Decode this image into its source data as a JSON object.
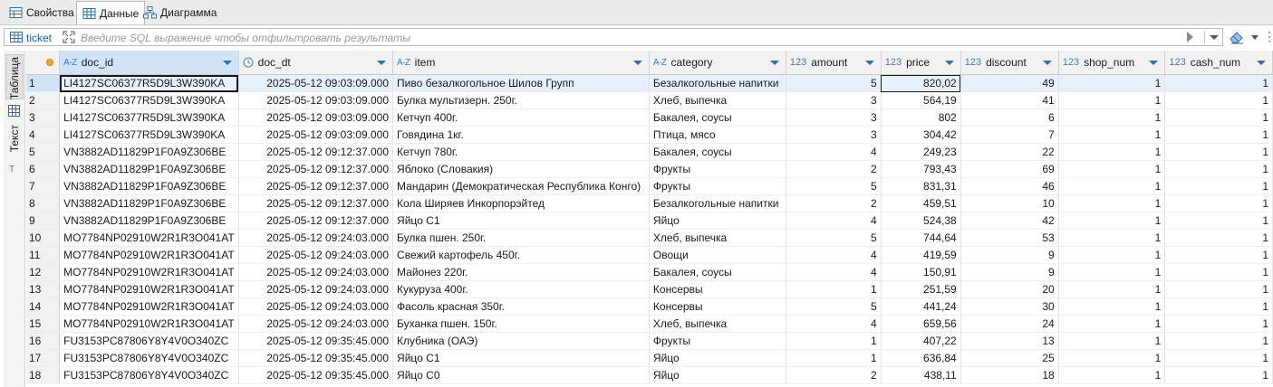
{
  "tabs": [
    {
      "label": "Свойства",
      "icon": "properties-icon"
    },
    {
      "label": "Данные",
      "icon": "grid-icon"
    },
    {
      "label": "Диаграмма",
      "icon": "diagram-icon"
    }
  ],
  "filter": {
    "table_name": "ticket",
    "placeholder": "Введите SQL выражение чтобы отфильтровать результаты"
  },
  "side_tabs": {
    "table": "Таблица",
    "text": "Текст"
  },
  "columns": [
    {
      "name": "doc_id",
      "type": "A-Z"
    },
    {
      "name": "doc_dt",
      "type": "clock"
    },
    {
      "name": "item",
      "type": "A-Z"
    },
    {
      "name": "category",
      "type": "A-Z"
    },
    {
      "name": "amount",
      "type": "123"
    },
    {
      "name": "price",
      "type": "123"
    },
    {
      "name": "discount",
      "type": "123"
    },
    {
      "name": "shop_num",
      "type": "123"
    },
    {
      "name": "cash_num",
      "type": "123"
    }
  ],
  "rows": [
    {
      "n": "1",
      "doc_id": "LI4127SC06377R5D9L3W390KA",
      "doc_dt": "2025-05-12 09:03:09.000",
      "item": "Пиво безалкогольное Шилов Групп",
      "category": "Безалкогольные напитки",
      "amount": "5",
      "price": "820,02",
      "discount": "49",
      "shop_num": "1",
      "cash_num": "1"
    },
    {
      "n": "2",
      "doc_id": "LI4127SC06377R5D9L3W390KA",
      "doc_dt": "2025-05-12 09:03:09.000",
      "item": "Булка мультизерн. 250г.",
      "category": "Хлеб, выпечка",
      "amount": "3",
      "price": "564,19",
      "discount": "41",
      "shop_num": "1",
      "cash_num": "1"
    },
    {
      "n": "3",
      "doc_id": "LI4127SC06377R5D9L3W390KA",
      "doc_dt": "2025-05-12 09:03:09.000",
      "item": "Кетчуп 400г.",
      "category": "Бакалея, соусы",
      "amount": "3",
      "price": "802",
      "discount": "6",
      "shop_num": "1",
      "cash_num": "1"
    },
    {
      "n": "4",
      "doc_id": "LI4127SC06377R5D9L3W390KA",
      "doc_dt": "2025-05-12 09:03:09.000",
      "item": "Говядина 1кг.",
      "category": "Птица, мясо",
      "amount": "3",
      "price": "304,42",
      "discount": "7",
      "shop_num": "1",
      "cash_num": "1"
    },
    {
      "n": "5",
      "doc_id": "VN3882AD11829P1F0A9Z306BE",
      "doc_dt": "2025-05-12 09:12:37.000",
      "item": "Кетчуп 780г.",
      "category": "Бакалея, соусы",
      "amount": "4",
      "price": "249,23",
      "discount": "22",
      "shop_num": "1",
      "cash_num": "1"
    },
    {
      "n": "6",
      "doc_id": "VN3882AD11829P1F0A9Z306BE",
      "doc_dt": "2025-05-12 09:12:37.000",
      "item": "Яблоко (Словакия)",
      "category": "Фрукты",
      "amount": "2",
      "price": "793,43",
      "discount": "69",
      "shop_num": "1",
      "cash_num": "1"
    },
    {
      "n": "7",
      "doc_id": "VN3882AD11829P1F0A9Z306BE",
      "doc_dt": "2025-05-12 09:12:37.000",
      "item": "Мандарин (Демократическая Республика Конго)",
      "category": "Фрукты",
      "amount": "5",
      "price": "831,31",
      "discount": "46",
      "shop_num": "1",
      "cash_num": "1"
    },
    {
      "n": "8",
      "doc_id": "VN3882AD11829P1F0A9Z306BE",
      "doc_dt": "2025-05-12 09:12:37.000",
      "item": "Кола Ширяев Инкорпорэйтед",
      "category": "Безалкогольные напитки",
      "amount": "2",
      "price": "459,51",
      "discount": "10",
      "shop_num": "1",
      "cash_num": "1"
    },
    {
      "n": "9",
      "doc_id": "VN3882AD11829P1F0A9Z306BE",
      "doc_dt": "2025-05-12 09:12:37.000",
      "item": "Яйцо С1",
      "category": "Яйцо",
      "amount": "4",
      "price": "524,38",
      "discount": "42",
      "shop_num": "1",
      "cash_num": "1"
    },
    {
      "n": "10",
      "doc_id": "MO7784NP02910W2R1R3O041AT",
      "doc_dt": "2025-05-12 09:24:03.000",
      "item": "Булка пшен. 250г.",
      "category": "Хлеб, выпечка",
      "amount": "5",
      "price": "744,64",
      "discount": "53",
      "shop_num": "1",
      "cash_num": "1"
    },
    {
      "n": "11",
      "doc_id": "MO7784NP02910W2R1R3O041AT",
      "doc_dt": "2025-05-12 09:24:03.000",
      "item": "Свежий картофель 450г.",
      "category": "Овощи",
      "amount": "4",
      "price": "419,59",
      "discount": "9",
      "shop_num": "1",
      "cash_num": "1"
    },
    {
      "n": "12",
      "doc_id": "MO7784NP02910W2R1R3O041AT",
      "doc_dt": "2025-05-12 09:24:03.000",
      "item": "Майонез 220г.",
      "category": "Бакалея, соусы",
      "amount": "4",
      "price": "150,91",
      "discount": "9",
      "shop_num": "1",
      "cash_num": "1"
    },
    {
      "n": "13",
      "doc_id": "MO7784NP02910W2R1R3O041AT",
      "doc_dt": "2025-05-12 09:24:03.000",
      "item": "Кукуруза 400г.",
      "category": "Консервы",
      "amount": "1",
      "price": "251,59",
      "discount": "20",
      "shop_num": "1",
      "cash_num": "1"
    },
    {
      "n": "14",
      "doc_id": "MO7784NP02910W2R1R3O041AT",
      "doc_dt": "2025-05-12 09:24:03.000",
      "item": "Фасоль красная 350г.",
      "category": "Консервы",
      "amount": "5",
      "price": "441,24",
      "discount": "30",
      "shop_num": "1",
      "cash_num": "1"
    },
    {
      "n": "15",
      "doc_id": "MO7784NP02910W2R1R3O041AT",
      "doc_dt": "2025-05-12 09:24:03.000",
      "item": "Буханка пшен. 150г.",
      "category": "Хлеб, выпечка",
      "amount": "4",
      "price": "659,56",
      "discount": "24",
      "shop_num": "1",
      "cash_num": "1"
    },
    {
      "n": "16",
      "doc_id": "FU3153PC87806Y8Y4V0O340ZC",
      "doc_dt": "2025-05-12 09:35:45.000",
      "item": "Клубника (ОАЭ)",
      "category": "Фрукты",
      "amount": "1",
      "price": "407,22",
      "discount": "13",
      "shop_num": "1",
      "cash_num": "1"
    },
    {
      "n": "17",
      "doc_id": "FU3153PC87806Y8Y4V0O340ZC",
      "doc_dt": "2025-05-12 09:35:45.000",
      "item": "Яйцо С1",
      "category": "Яйцо",
      "amount": "1",
      "price": "636,84",
      "discount": "25",
      "shop_num": "1",
      "cash_num": "1"
    },
    {
      "n": "18",
      "doc_id": "FU3153PC87806Y8Y4V0O340ZC",
      "doc_dt": "2025-05-12 09:35:45.000",
      "item": "Яйцо С0",
      "category": "Яйцо",
      "amount": "2",
      "price": "438,11",
      "discount": "18",
      "shop_num": "1",
      "cash_num": "1"
    }
  ]
}
